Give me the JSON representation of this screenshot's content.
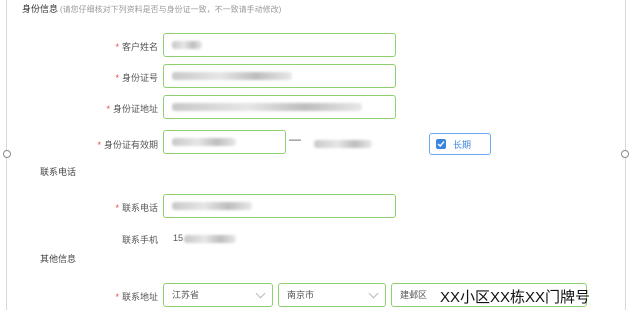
{
  "section": {
    "title": "身份信息",
    "hint": "(请您仔细核对下列资料是否与身份证一致，不一致请手动修改)"
  },
  "groups": {
    "contact": "联系电话",
    "other": "其他信息"
  },
  "fields": {
    "customer_name": {
      "label": "客户姓名"
    },
    "id_number": {
      "label": "身份证号"
    },
    "id_address": {
      "label": "身份证地址"
    },
    "id_validity": {
      "label": "身份证有效期",
      "separator": "—",
      "long_term_label": "长期"
    },
    "contact_phone": {
      "label": "联系电话"
    },
    "mobile": {
      "label": "联系手机",
      "value_prefix": "15"
    },
    "address": {
      "label": "联系地址",
      "province": "江苏省",
      "city": "南京市",
      "district": "建邺区",
      "detail": "XX小区XX栋XX门牌号"
    }
  },
  "colors": {
    "valid_border": "#8fd16e",
    "required_mark": "#e84848",
    "accent": "#3a84e0"
  }
}
